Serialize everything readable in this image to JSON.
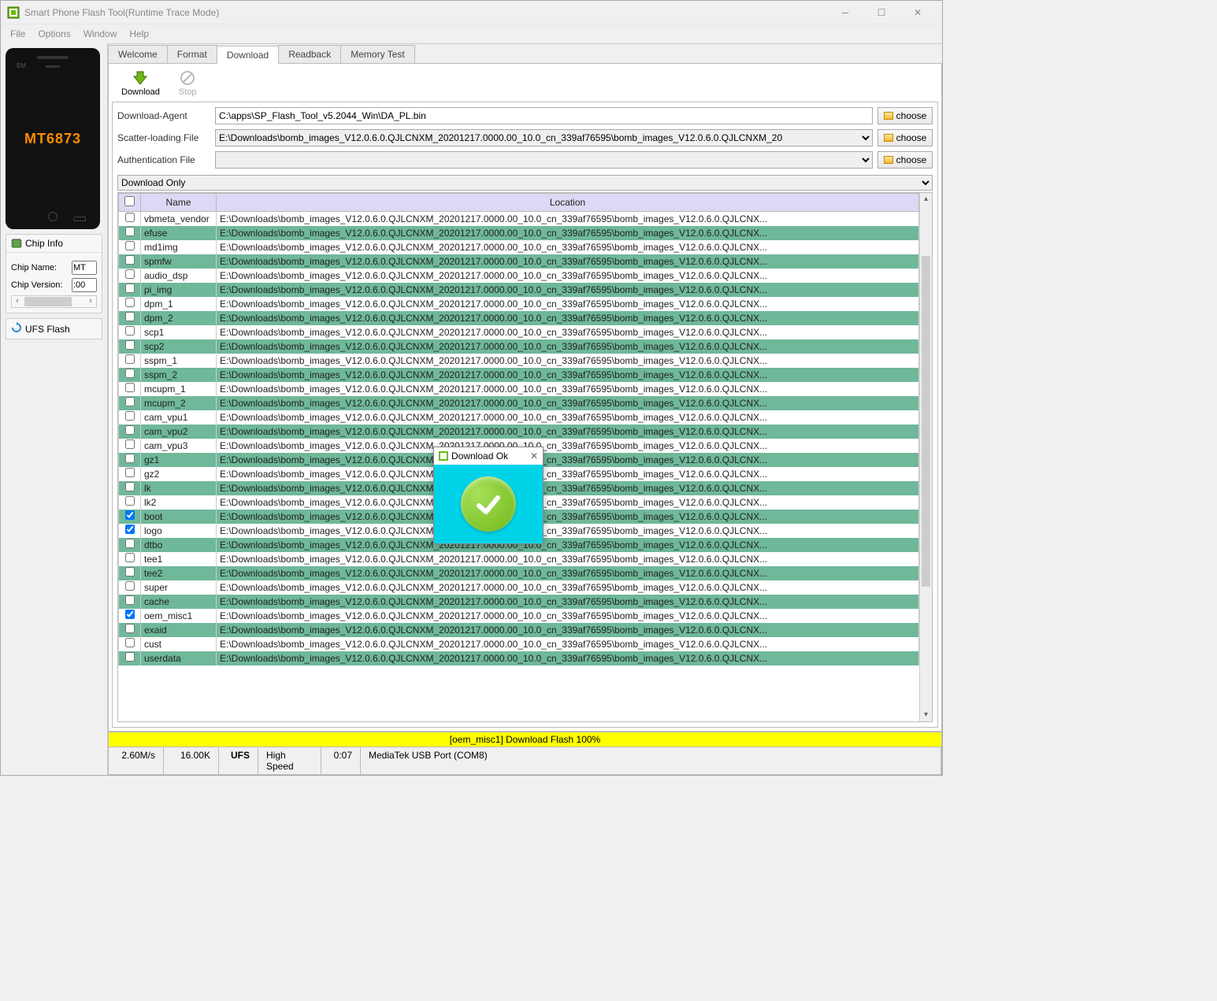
{
  "window": {
    "title": "Smart Phone Flash Tool(Runtime Trace Mode)"
  },
  "menu": {
    "file": "File",
    "options": "Options",
    "window": "Window",
    "help": "Help"
  },
  "phone": {
    "chip": "MT6873",
    "bm": "BM"
  },
  "chipinfo": {
    "header": "Chip Info",
    "name_label": "Chip Name:",
    "name_value": "MT",
    "ver_label": "Chip Version:",
    "ver_value": ":00"
  },
  "ufs": {
    "label": "UFS Flash"
  },
  "tabs": {
    "welcome": "Welcome",
    "format": "Format",
    "download": "Download",
    "readback": "Readback",
    "memtest": "Memory Test"
  },
  "toolbar": {
    "download": "Download",
    "stop": "Stop"
  },
  "form": {
    "da_label": "Download-Agent",
    "da_value": "C:\\apps\\SP_Flash_Tool_v5.2044_Win\\DA_PL.bin",
    "scatter_label": "Scatter-loading File",
    "scatter_value": "E:\\Downloads\\bomb_images_V12.0.6.0.QJLCNXM_20201217.0000.00_10.0_cn_339af76595\\bomb_images_V12.0.6.0.QJLCNXM_20",
    "auth_label": "Authentication File",
    "auth_value": "",
    "choose": "choose",
    "mode": "Download Only"
  },
  "table": {
    "hdr_name": "Name",
    "hdr_location": "Location",
    "loc": "E:\\Downloads\\bomb_images_V12.0.6.0.QJLCNXM_20201217.0000.00_10.0_cn_339af76595\\bomb_images_V12.0.6.0.QJLCNX...",
    "loc_clip": "E:\\Downloads\\bomb_images",
    "loc_clip2": "E:\\Downloads\\bomb_images_V12.0.6.0.QJLCNXM_2020",
    "loc_tail": "217.0000.00_10.0_cn_339af76595\\bomb_images_V12.0.6.0.QJLCNX...",
    "rows": [
      {
        "name": "vbmeta_vendor",
        "green": false,
        "checked": false
      },
      {
        "name": "efuse",
        "green": true,
        "checked": false
      },
      {
        "name": "md1img",
        "green": false,
        "checked": false
      },
      {
        "name": "spmfw",
        "green": true,
        "checked": false
      },
      {
        "name": "audio_dsp",
        "green": false,
        "checked": false
      },
      {
        "name": "pi_img",
        "green": true,
        "checked": false
      },
      {
        "name": "dpm_1",
        "green": false,
        "checked": false
      },
      {
        "name": "dpm_2",
        "green": true,
        "checked": false
      },
      {
        "name": "scp1",
        "green": false,
        "checked": false
      },
      {
        "name": "scp2",
        "green": true,
        "checked": false
      },
      {
        "name": "sspm_1",
        "green": false,
        "checked": false
      },
      {
        "name": "sspm_2",
        "green": true,
        "checked": false
      },
      {
        "name": "mcupm_1",
        "green": false,
        "checked": false
      },
      {
        "name": "mcupm_2",
        "green": true,
        "checked": false
      },
      {
        "name": "cam_vpu1",
        "green": false,
        "checked": false
      },
      {
        "name": "cam_vpu2",
        "green": true,
        "checked": false
      },
      {
        "name": "cam_vpu3",
        "green": false,
        "checked": false
      },
      {
        "name": "gz1",
        "green": true,
        "checked": false
      },
      {
        "name": "gz2",
        "green": false,
        "checked": false
      },
      {
        "name": "lk",
        "green": true,
        "checked": false
      },
      {
        "name": "lk2",
        "green": false,
        "checked": false
      },
      {
        "name": "boot",
        "green": true,
        "checked": true
      },
      {
        "name": "logo",
        "green": false,
        "checked": true
      },
      {
        "name": "dtbo",
        "green": true,
        "checked": false
      },
      {
        "name": "tee1",
        "green": false,
        "checked": false
      },
      {
        "name": "tee2",
        "green": true,
        "checked": false
      },
      {
        "name": "super",
        "green": false,
        "checked": false
      },
      {
        "name": "cache",
        "green": true,
        "checked": false
      },
      {
        "name": "oem_misc1",
        "green": false,
        "checked": true
      },
      {
        "name": "exaid",
        "green": true,
        "checked": false
      },
      {
        "name": "cust",
        "green": false,
        "checked": false
      },
      {
        "name": "userdata",
        "green": true,
        "checked": false
      }
    ]
  },
  "dialog": {
    "title": "Download Ok"
  },
  "status": {
    "yellow": "[oem_misc1] Download Flash 100%",
    "speed": "2.60M/s",
    "size": "16.00K",
    "storage": "UFS",
    "usbspeed": "High Speed",
    "time": "0:07",
    "port": "MediaTek USB Port (COM8)"
  }
}
